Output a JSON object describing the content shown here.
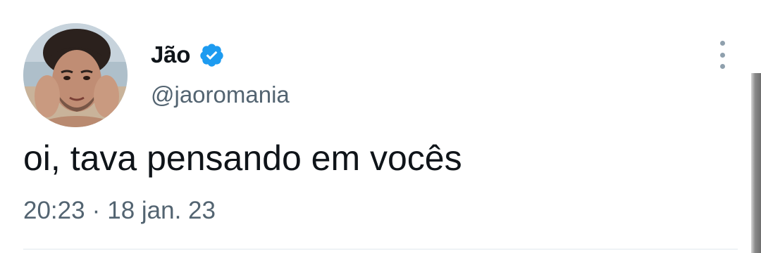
{
  "tweet": {
    "author": {
      "display_name": "Jão",
      "handle": "@jaoromania",
      "verified": true,
      "avatar_icon": "profile-photo"
    },
    "text": "oi, tava pensando em vocês",
    "time": "20:23",
    "separator": "·",
    "date": "18 jan. 23"
  },
  "icons": {
    "verified": "verified-badge-icon",
    "more": "more-options-icon"
  },
  "colors": {
    "verified_badge": "#1d9bf0",
    "text_primary": "#0f1419",
    "text_secondary": "#536471"
  }
}
